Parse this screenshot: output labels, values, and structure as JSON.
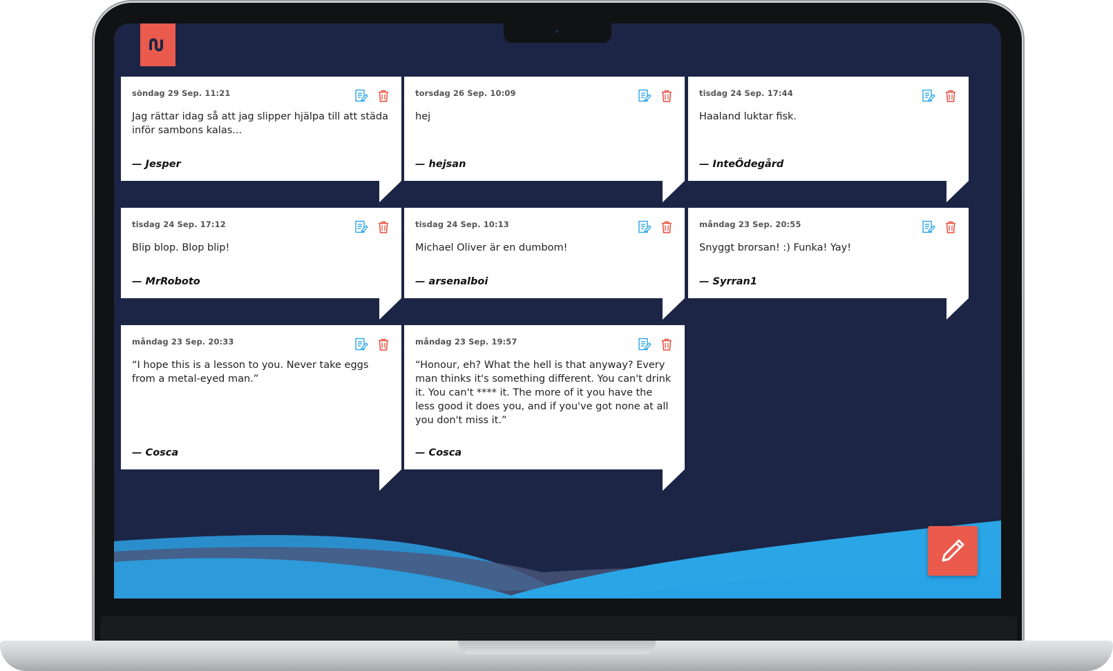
{
  "app": {
    "brand_color": "#ea5b4d",
    "background_color": "#1c2545",
    "accent_blue": "#2aa6e6"
  },
  "notes": [
    {
      "date": "söndag 29 Sep. 11:21",
      "text": "Jag rättar idag så att jag slipper hjälpa till att städa inför sambons kalas...",
      "author": "— Jesper"
    },
    {
      "date": "torsdag 26 Sep. 10:09",
      "text": "hej",
      "author": "— hejsan"
    },
    {
      "date": "tisdag 24 Sep. 17:44",
      "text": "Haaland luktar fisk.",
      "author": "— InteÖdegård"
    },
    {
      "date": "tisdag 24 Sep. 17:12",
      "text": "Blip blop. Blop blip!",
      "author": "— MrRoboto"
    },
    {
      "date": "tisdag 24 Sep. 10:13",
      "text": "Michael Oliver är en dumbom!",
      "author": "— arsenalboi"
    },
    {
      "date": "måndag 23 Sep. 20:55",
      "text": "Snyggt brorsan! :) Funka! Yay!",
      "author": "— Syrran1"
    },
    {
      "date": "måndag 23 Sep. 20:33",
      "text": "“I hope this is a lesson to you. Never take eggs from a metal-eyed man.”",
      "author": "— Cosca"
    },
    {
      "date": "måndag 23 Sep. 19:57",
      "text": "“Honour, eh? What the hell is that anyway? Every man thinks it's something different. You can't drink it. You can't **** it. The more of it you have the less good it does you, and if you've got none at all you don't miss it.”",
      "author": "— Cosca"
    }
  ],
  "icons": {
    "edit": "edit-icon",
    "delete": "trash-icon",
    "fab": "pencil-icon",
    "logo": "brand-logo"
  }
}
